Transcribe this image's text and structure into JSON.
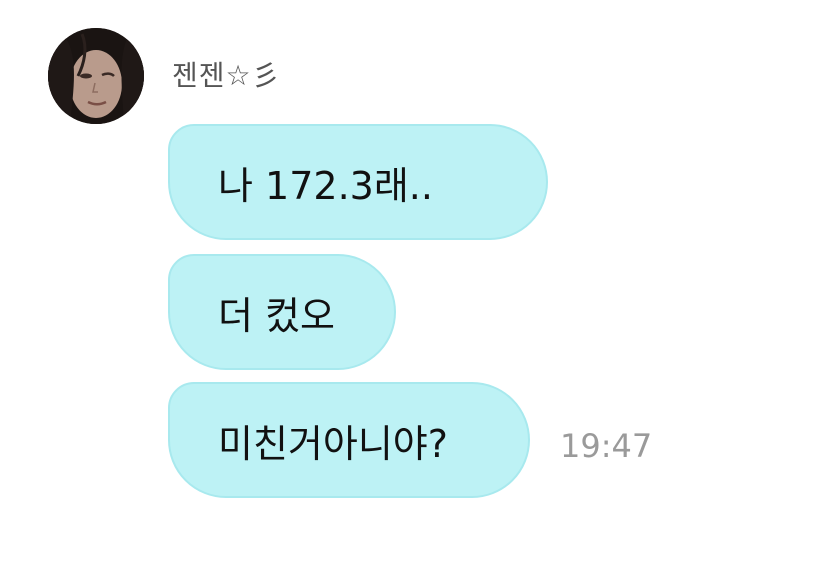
{
  "sender": {
    "name": "젠젠☆彡",
    "avatar": "profile-photo"
  },
  "messages": [
    {
      "text": "나 172.3래.."
    },
    {
      "text": "더 컸오"
    },
    {
      "text": "미친거아니야?"
    }
  ],
  "timestamp": "19:47",
  "colors": {
    "bubble": "#bdf2f5",
    "bubble_border": "#a8e9ee",
    "timestamp": "#9a9a9a",
    "name": "#555555"
  }
}
